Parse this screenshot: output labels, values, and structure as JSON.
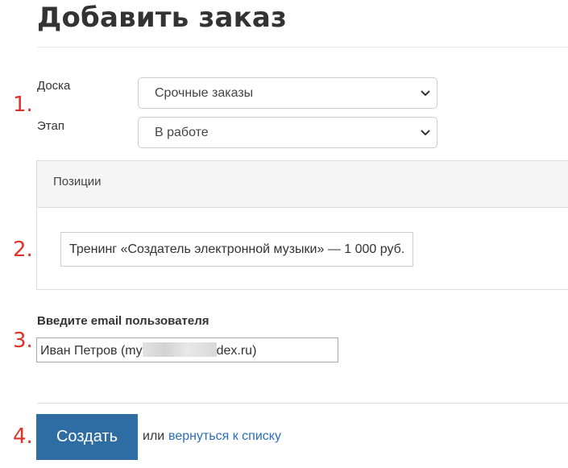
{
  "page": {
    "title": "Добавить заказ"
  },
  "steps": {
    "one": "1.",
    "two": "2.",
    "three": "3.",
    "four": "4."
  },
  "form": {
    "board_label": "Доска",
    "board_value": "Срочные заказы",
    "stage_label": "Этап",
    "stage_value": "В работе"
  },
  "positions": {
    "header": "Позиции",
    "items": [
      "Тренинг «Создатель электронной музыки» — 1 000 руб."
    ]
  },
  "email": {
    "label": "Введите email пользователя",
    "value_prefix": "Иван Петров (my",
    "value_suffix": "dex.ru)"
  },
  "actions": {
    "create_label": "Создать",
    "or_text": "или",
    "back_link": "вернуться к списку"
  },
  "colors": {
    "accent": "#2e6da4",
    "link": "#2a6ebb",
    "step_number": "#e0322b"
  },
  "icons": {
    "select_arrow": "chevron-down-icon"
  }
}
